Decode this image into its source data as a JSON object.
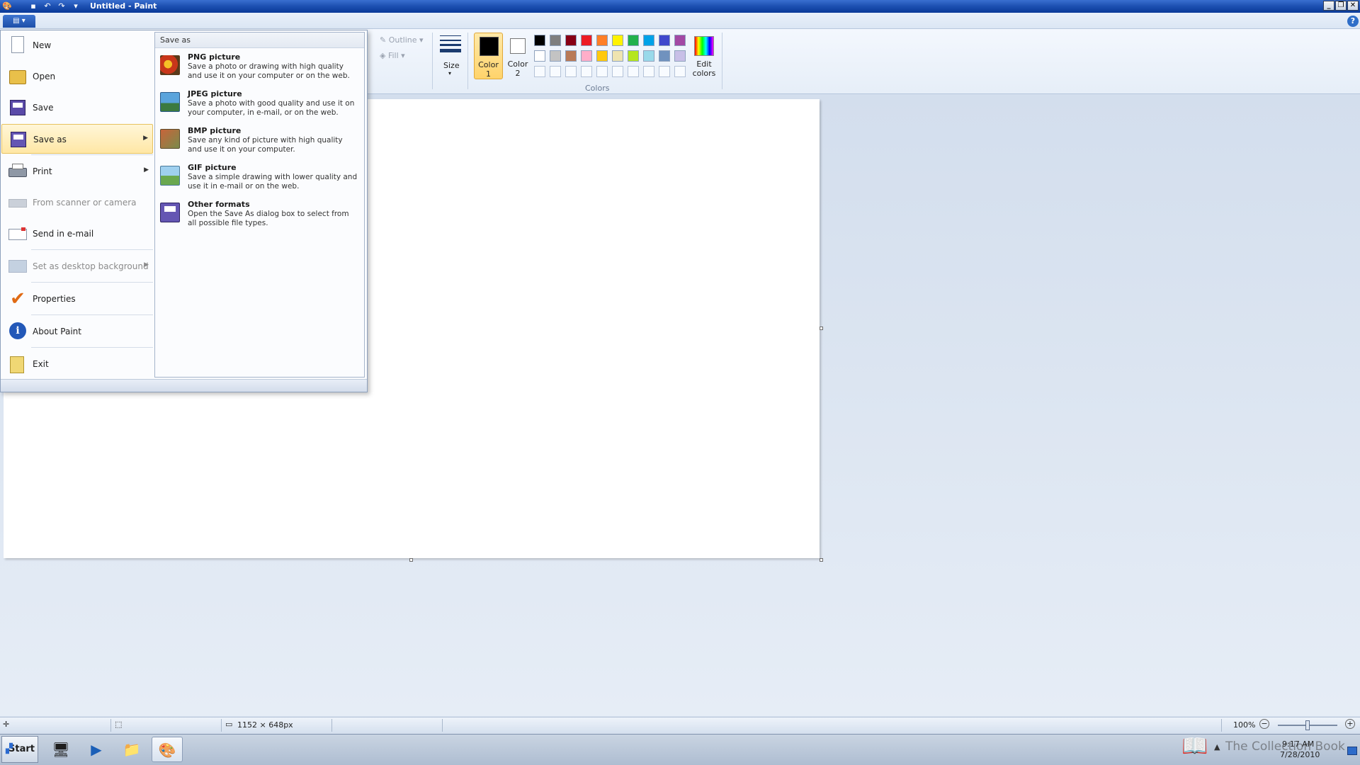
{
  "window": {
    "title": "Untitled - Paint",
    "controls": [
      "minimize",
      "restore",
      "close"
    ]
  },
  "quick_access": [
    "paint-app-icon",
    "save-icon",
    "undo-icon",
    "redo-icon",
    "customize-icon"
  ],
  "ribbon": {
    "shapes": {
      "outline_label": "Outline",
      "fill_label": "Fill"
    },
    "size_label": "Size",
    "color1": {
      "label_line1": "Color",
      "label_line2": "1",
      "value": "#000000"
    },
    "color2": {
      "label_line1": "Color",
      "label_line2": "2",
      "value": "#ffffff"
    },
    "palette_row1": [
      "#000000",
      "#7f7f7f",
      "#880015",
      "#ed1c24",
      "#ff7f27",
      "#fff200",
      "#22b14c",
      "#00a2e8",
      "#3f48cc",
      "#a349a4"
    ],
    "palette_row2": [
      "#ffffff",
      "#c3c3c3",
      "#b97a57",
      "#ffaec9",
      "#ffc90e",
      "#efe4b0",
      "#b5e61d",
      "#99d9ea",
      "#7092be",
      "#c8bfe7"
    ],
    "edit_colors": {
      "line1": "Edit",
      "line2": "colors"
    },
    "colors_group_label": "Colors"
  },
  "file_menu": {
    "items": [
      {
        "label": "New",
        "icon": "new-document-icon",
        "enabled": true
      },
      {
        "label": "Open",
        "icon": "open-folder-icon",
        "enabled": true
      },
      {
        "label": "Save",
        "icon": "save-disk-icon",
        "enabled": true
      },
      {
        "label": "Save as",
        "icon": "save-as-icon",
        "enabled": true,
        "has_submenu": true,
        "selected": true
      },
      {
        "label": "Print",
        "icon": "printer-icon",
        "enabled": true,
        "has_submenu": true
      },
      {
        "label": "From scanner or camera",
        "icon": "scanner-icon",
        "enabled": false
      },
      {
        "label": "Send in e-mail",
        "icon": "email-icon",
        "enabled": true
      },
      {
        "label": "Set as desktop background",
        "icon": "desktop-background-icon",
        "enabled": false,
        "has_submenu": true
      },
      {
        "label": "Properties",
        "icon": "checkmark-icon",
        "enabled": true
      },
      {
        "label": "About Paint",
        "icon": "info-icon",
        "enabled": true
      },
      {
        "label": "Exit",
        "icon": "exit-icon",
        "enabled": true
      }
    ]
  },
  "save_as_submenu": {
    "header": "Save as",
    "items": [
      {
        "title": "PNG picture",
        "description": "Save a photo or drawing with high quality and use it on your computer or on the web.",
        "icon": "png-picture-icon"
      },
      {
        "title": "JPEG picture",
        "description": "Save a photo with good quality and use it on your computer, in e-mail, or on the web.",
        "icon": "jpeg-picture-icon"
      },
      {
        "title": "BMP picture",
        "description": "Save any kind of picture with high quality and use it on your computer.",
        "icon": "bmp-picture-icon"
      },
      {
        "title": "GIF picture",
        "description": "Save a simple drawing with lower quality and use it in e-mail or on the web.",
        "icon": "gif-picture-icon"
      },
      {
        "title": "Other formats",
        "description": "Open the Save As dialog box to select from all possible file types.",
        "icon": "other-formats-icon"
      }
    ]
  },
  "status_bar": {
    "canvas_size": "1152 × 648px",
    "zoom": "100%"
  },
  "taskbar": {
    "start_label": "Start",
    "apps": [
      "server-manager-icon",
      "powershell-icon",
      "explorer-folder-icon",
      "paint-taskbar-icon"
    ],
    "clock_time": "9:17 AM",
    "clock_date": "7/28/2010",
    "watermark": "The Collection Book"
  }
}
